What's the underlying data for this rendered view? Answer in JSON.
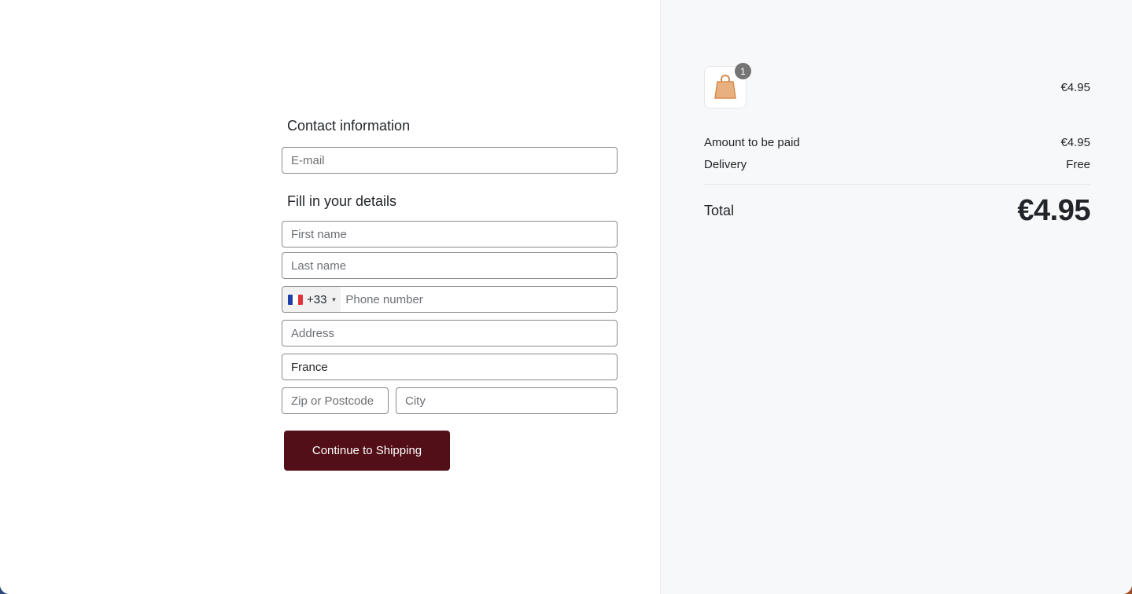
{
  "contact": {
    "title": "Contact information",
    "email_placeholder": "E-mail"
  },
  "details": {
    "title": "Fill in your details",
    "first_name_placeholder": "First name",
    "last_name_placeholder": "Last name",
    "phone": {
      "country_flag": "flag-france-icon",
      "dial_code": "+33",
      "placeholder": "Phone number"
    },
    "address_placeholder": "Address",
    "country_value": "France",
    "zip_placeholder": "Zip or Postcode",
    "city_placeholder": "City"
  },
  "actions": {
    "continue_label": "Continue to Shipping"
  },
  "summary": {
    "item": {
      "icon": "shopping-bag-icon",
      "quantity": "1",
      "price": "€4.95"
    },
    "amount_label": "Amount to be paid",
    "amount_value": "€4.95",
    "delivery_label": "Delivery",
    "delivery_value": "Free",
    "total_label": "Total",
    "total_value": "€4.95"
  },
  "colors": {
    "primary_button": "#520f17",
    "summary_background": "#f7f8fa",
    "bag_icon": "#e8a66f"
  }
}
